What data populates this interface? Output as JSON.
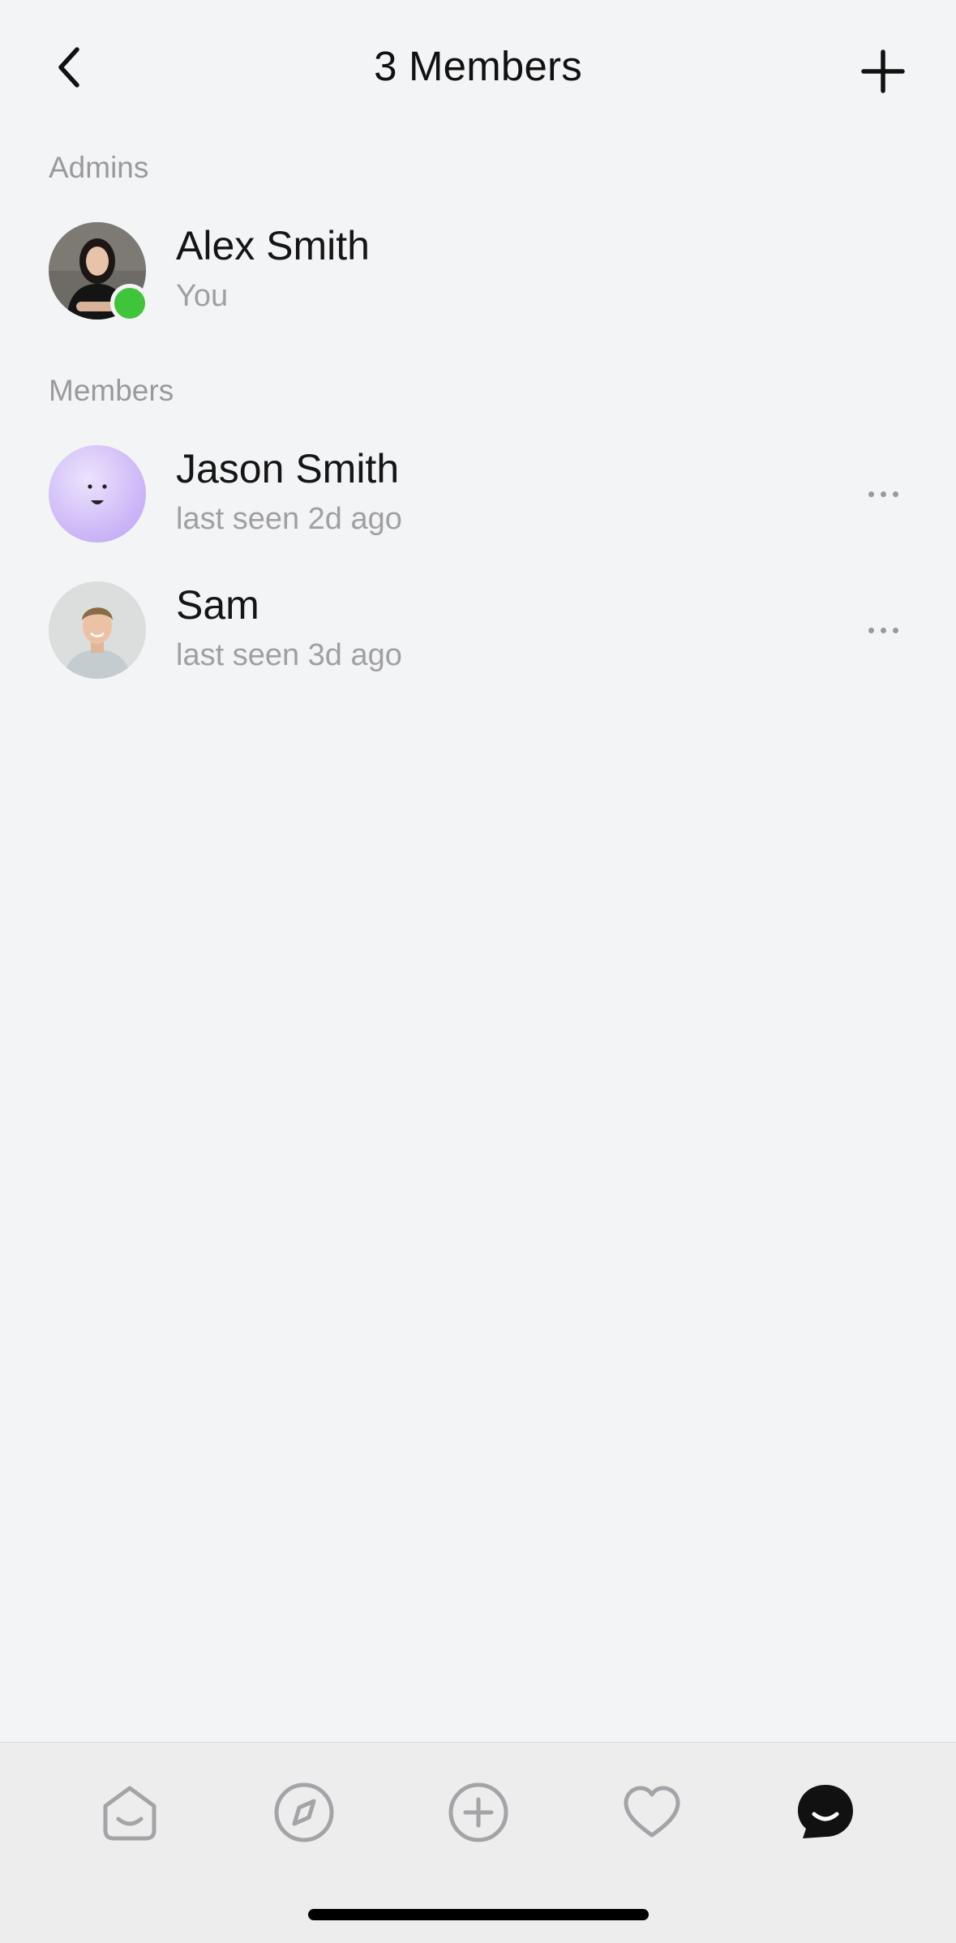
{
  "header": {
    "title": "3 Members",
    "back_icon": "chevron-left-icon",
    "add_icon": "plus-icon"
  },
  "sections": {
    "admins_label": "Admins",
    "members_label": "Members"
  },
  "admins": [
    {
      "name": "Alex Smith",
      "subtitle": "You",
      "online": true,
      "avatar": "photo-woman"
    }
  ],
  "members": [
    {
      "name": "Jason Smith",
      "subtitle": "last seen 2d ago",
      "avatar": "purple-smiley"
    },
    {
      "name": "Sam",
      "subtitle": "last seen 3d ago",
      "avatar": "photo-man"
    }
  ],
  "tabbar": {
    "items": [
      {
        "icon": "home-icon",
        "active": false
      },
      {
        "icon": "compass-icon",
        "active": false
      },
      {
        "icon": "plus-circle-icon",
        "active": false
      },
      {
        "icon": "heart-icon",
        "active": false
      },
      {
        "icon": "chat-smile-icon",
        "active": true
      }
    ]
  },
  "colors": {
    "background": "#f3f4f6",
    "online": "#3fc43a",
    "secondary_text": "#a0a0a4",
    "purple_avatar": "#c9b3f5"
  }
}
